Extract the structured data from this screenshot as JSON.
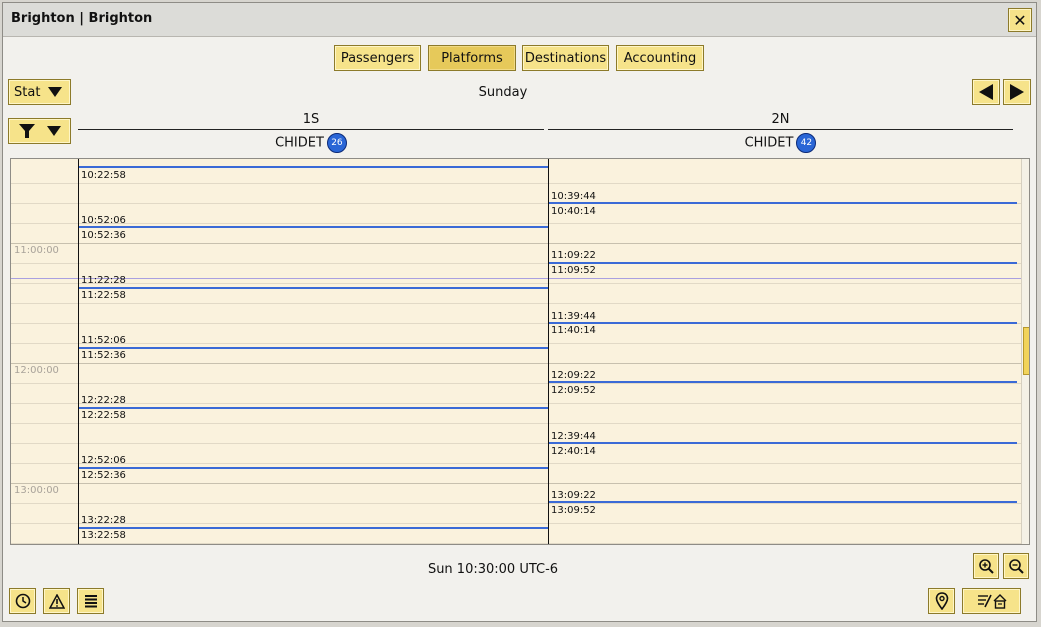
{
  "window": {
    "title": "Brighton | Brighton",
    "close_label": "✕"
  },
  "tabs": [
    {
      "label": "Passengers",
      "active": false
    },
    {
      "label": "Platforms",
      "active": true
    },
    {
      "label": "Destinations",
      "active": false
    },
    {
      "label": "Accounting",
      "active": false
    }
  ],
  "toolbar": {
    "stat_label": "Stat",
    "day": "Sunday"
  },
  "columns": [
    {
      "platform": "1S",
      "line": "CHIDET",
      "badge": "26"
    },
    {
      "platform": "2N",
      "line": "CHIDET",
      "badge": "42"
    }
  ],
  "hour_labels": [
    "11:00:00",
    "12:00:00",
    "13:00:00"
  ],
  "left_times": [
    "10:22:58",
    "10:52:06",
    "10:52:36",
    "11:22:28",
    "11:22:58",
    "11:52:06",
    "11:52:36",
    "12:22:28",
    "12:22:58",
    "12:52:06",
    "12:52:36",
    "13:22:28",
    "13:22:58"
  ],
  "right_times": [
    "10:39:44",
    "10:40:14",
    "11:09:22",
    "11:09:52",
    "11:39:44",
    "11:40:14",
    "12:09:22",
    "12:09:52",
    "12:39:44",
    "12:40:14",
    "13:09:22",
    "13:09:52"
  ],
  "status": {
    "clock": "Sun 10:30:00 UTC-6"
  },
  "colors": {
    "accent": "#f6e38a",
    "badge": "#2a66d6",
    "event_line": "#3a6ad6",
    "grid_bg": "#faf2dd"
  },
  "icons": [
    "stat-dropdown-icon",
    "filter-icon",
    "prev-arrow-icon",
    "next-arrow-icon",
    "zoom-in-icon",
    "zoom-out-icon",
    "clock-icon",
    "warning-icon",
    "list-icon",
    "location-pin-icon",
    "notes-station-icon"
  ]
}
